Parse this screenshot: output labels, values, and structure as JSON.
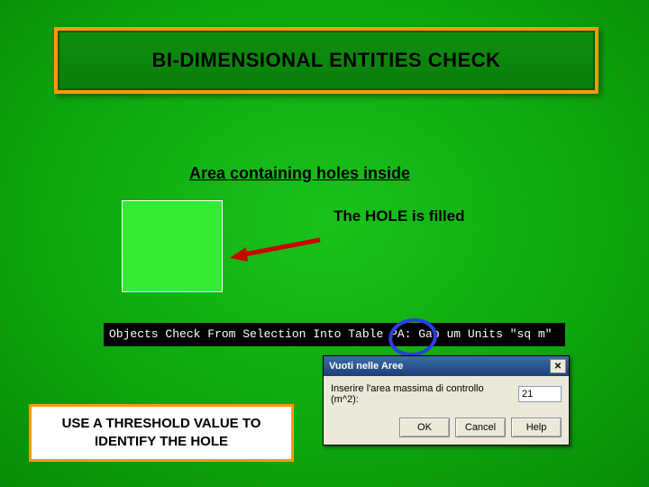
{
  "title": "BI-DIMENSIONAL ENTITIES CHECK",
  "subtitle": "Area containing holes inside",
  "hole_filled_label": "The HOLE is filled",
  "console_text": "Objects Check From Selection Into Table PA:  Gap  um Units \"sq m\"",
  "dialog": {
    "title": "Vuoti nelle Aree",
    "prompt": "Inserire l'area massima di controllo (m^2):",
    "value": "21",
    "buttons": {
      "ok": "OK",
      "cancel": "Cancel",
      "help": "Help"
    }
  },
  "threshold_box": "USE A THRESHOLD VALUE TO IDENTIFY THE HOLE",
  "colors": {
    "accent_orange": "#ff9900",
    "circle": "#2a3fe2"
  }
}
